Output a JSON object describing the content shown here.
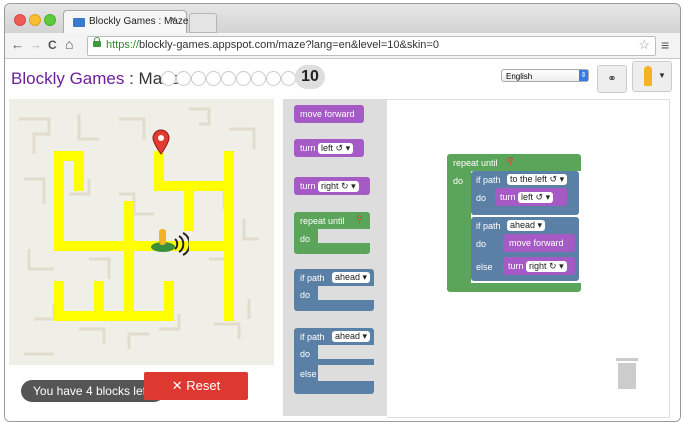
{
  "browser": {
    "tab_title": "Blockly Games : Maze",
    "tab_close": "×",
    "url_scheme": "https://",
    "url_rest": "blockly-games.appspot.com/maze?lang=en&level=10&skin=0",
    "back": "←",
    "forward": "→",
    "reload": "C",
    "home": "⌂",
    "star": "☆",
    "menu": "≡"
  },
  "app": {
    "title_app": "Blockly Games",
    "title_sep": " : ",
    "title_page": "Maze",
    "level": "10",
    "language": "English",
    "link_icon": "⚭",
    "peg_caret": "▼"
  },
  "maze": {
    "status": "You have 4 blocks left.",
    "reset_label": "✕ Reset"
  },
  "toolbox": {
    "move_forward": "move forward",
    "turn1_label": "turn",
    "turn1_value": "left ↺ ▾",
    "turn2_label": "turn",
    "turn2_value": "right ↻ ▾",
    "repeat_label": "repeat until",
    "repeat_do": "do",
    "if_label": "if path",
    "if_value": "ahead ▾",
    "if_do": "do",
    "ifelse_label": "if path",
    "ifelse_value": "ahead ▾",
    "ifelse_do": "do",
    "ifelse_else": "else"
  },
  "workspace": {
    "repeat_label": "repeat until",
    "repeat_do": "do",
    "if1_label": "if path",
    "if1_value": "to the left ↺ ▾",
    "if1_do": "do",
    "turn1_label": "turn",
    "turn1_value": "left ↺ ▾",
    "if2_label": "if path",
    "if2_value": "ahead ▾",
    "if2_do": "do",
    "move_label": "move forward",
    "if2_else": "else",
    "turn2_label": "turn",
    "turn2_value": "right ↻ ▾"
  },
  "colors": {
    "path": "#ffff00",
    "purple_block": "#a65ac6",
    "blue_block": "#5b80a5",
    "green_block": "#5ba55b",
    "reset": "#dd3931"
  },
  "icons": [
    "marker-icon",
    "pegman-icon",
    "trash-icon",
    "link-icon",
    "lock-icon"
  ]
}
